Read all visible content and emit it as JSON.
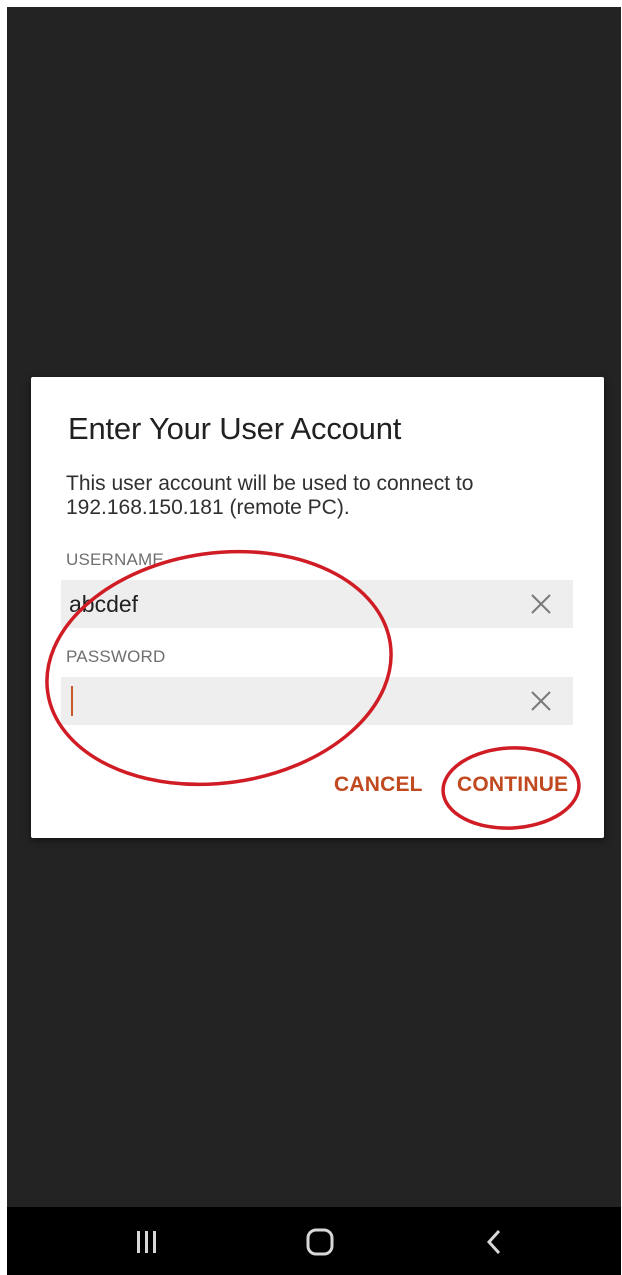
{
  "dialog": {
    "title": "Enter Your User Account",
    "message": "This user account will be used to connect to 192.168.150.181 (remote PC).",
    "username_label": "USERNAME",
    "username_value": "abcdef",
    "password_label": "PASSWORD",
    "password_value": "",
    "cancel_label": "CANCEL",
    "continue_label": "CONTINUE"
  },
  "icons": {
    "clear": "close-icon",
    "nav_recents": "recents-icon",
    "nav_home": "home-icon",
    "nav_back": "back-icon"
  },
  "colors": {
    "accent": "#c0491f",
    "annotation": "#d01c24",
    "screen_bg": "#232323",
    "field_bg": "#eeeeee"
  }
}
